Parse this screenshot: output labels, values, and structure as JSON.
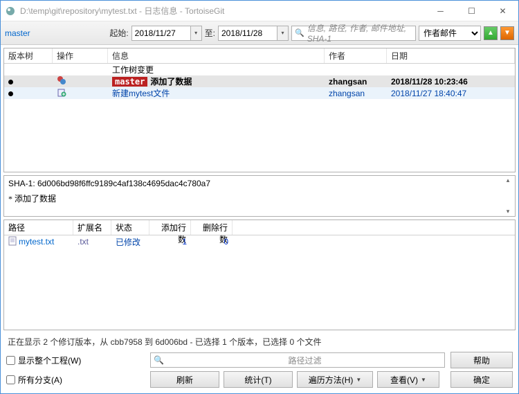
{
  "titlebar": {
    "text": "D:\\temp\\git\\repository\\mytest.txt - 日志信息 - TortoiseGit"
  },
  "toolbar": {
    "branch": "master",
    "from_label": "起始:",
    "from_date": "2018/11/27",
    "to_label": "至:",
    "to_date": "2018/11/28",
    "filter_placeholder": "信息, 路径, 作者, 邮件地址, SHA-1",
    "author_filter": "作者邮件"
  },
  "commit_headers": {
    "tree": "版本树",
    "op": "操作",
    "msg": "信息",
    "author": "作者",
    "date": "日期"
  },
  "commits": [
    {
      "msg": "工作树变更",
      "author": "",
      "date": "",
      "style": "worktree"
    },
    {
      "branch": "master",
      "msg": "添加了数据",
      "author": "zhangsan",
      "date": "2018/11/28 10:23:46",
      "style": "sel"
    },
    {
      "msg": "新建mytest文件",
      "author": "zhangsan",
      "date": "2018/11/27 18:40:47",
      "style": "alt"
    }
  ],
  "detail": {
    "sha_line": "SHA-1: 6d006bd98f6ffc9189c4af138c4695dac4c780a7",
    "subject": "* 添加了数据"
  },
  "file_headers": {
    "path": "路径",
    "ext": "扩展名",
    "status": "状态",
    "add": "添加行数",
    "del": "删除行数"
  },
  "files": [
    {
      "path": "mytest.txt",
      "ext": ".txt",
      "status": "已修改",
      "add": "1",
      "del": "0"
    }
  ],
  "status_line": "正在显示 2 个修订版本，从 cbb7958 到 6d006bd - 已选择 1 个版本，已选择 0 个文件",
  "bottom": {
    "chk_whole": "显示整个工程(W)",
    "chk_all_branches": "所有分支(A)",
    "path_filter_placeholder": "路径过滤",
    "help": "帮助",
    "refresh": "刷新",
    "stats": "统计(T)",
    "walk": "遍历方法(H)",
    "view": "查看(V)",
    "ok": "确定"
  }
}
